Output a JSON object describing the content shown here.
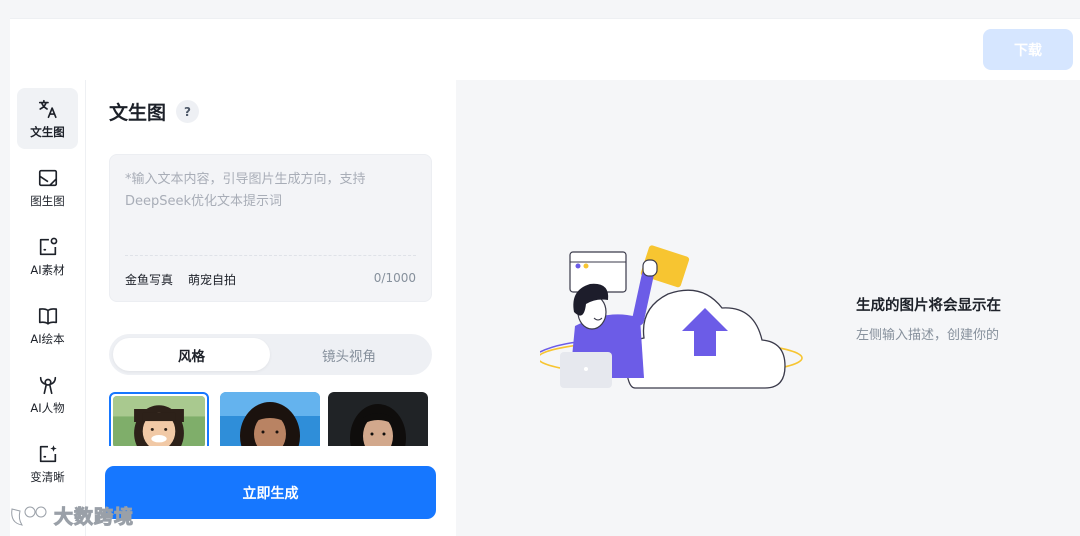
{
  "toolbar": {
    "download_label": "下载"
  },
  "sidebar": {
    "items": [
      {
        "label": "文生图",
        "icon": "text-to-image-icon",
        "active": true
      },
      {
        "label": "图生图",
        "icon": "image-to-image-icon",
        "active": false
      },
      {
        "label": "AI素材",
        "icon": "ai-material-icon",
        "active": false
      },
      {
        "label": "AI绘本",
        "icon": "book-icon",
        "active": false
      },
      {
        "label": "AI人物",
        "icon": "person-icon",
        "active": false
      },
      {
        "label": "变清晰",
        "icon": "enhance-icon",
        "active": false
      }
    ]
  },
  "panel": {
    "title": "文生图",
    "help": "?",
    "prompt": {
      "value": "",
      "placeholder": "*输入文本内容，引导图片生成方向，支持DeepSeek优化文本提示词",
      "chips": [
        "金鱼写真",
        "萌宠自拍"
      ],
      "counter": "0/1000"
    },
    "tabs": [
      "风格",
      "镜头视角"
    ],
    "active_tab": "风格",
    "generate_label": "立即生成"
  },
  "canvas": {
    "empty_title": "生成的图片将会显示在",
    "empty_subtitle": "左侧输入描述，创建你的"
  },
  "watermark": "大数跨境",
  "colors": {
    "primary": "#1677ff",
    "download_disabled": "#d6e6ff",
    "illustration_purple": "#6c5ce7",
    "illustration_yellow": "#f7c531"
  }
}
